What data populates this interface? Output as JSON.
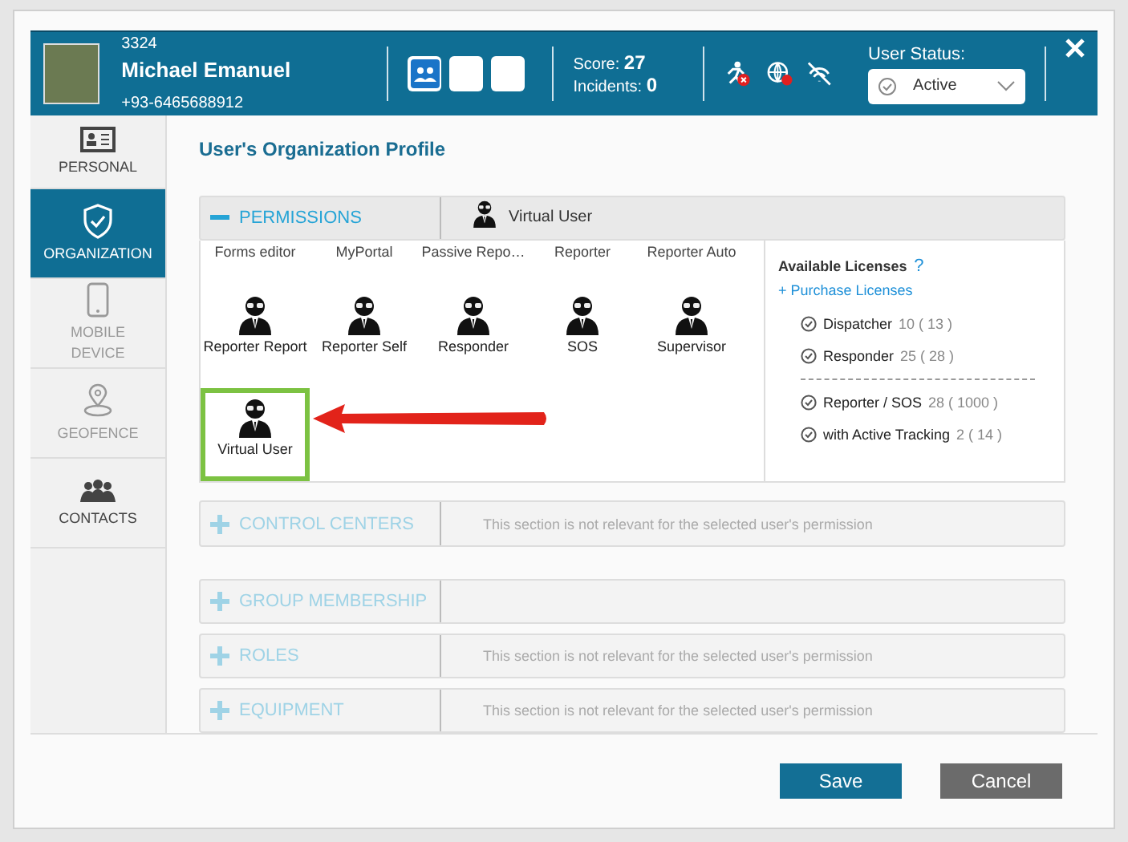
{
  "header": {
    "user_id": "3324",
    "name": "Michael Emanuel",
    "phone": "+93-6465688912",
    "score_label": "Score:",
    "score": "27",
    "incidents_label": "Incidents:",
    "incidents": "0",
    "status_label": "User Status:",
    "status_value": "Active"
  },
  "sidebar": {
    "items": [
      {
        "kind": "card",
        "label": "PERSONAL",
        "selected": false,
        "disabled": false
      },
      {
        "kind": "shield",
        "label": "ORGANIZATION",
        "selected": true,
        "disabled": false
      },
      {
        "kind": "phone",
        "label": "MOBILE DEVICE",
        "selected": false,
        "disabled": true
      },
      {
        "kind": "pin",
        "label": "GEOFENCE",
        "selected": false,
        "disabled": true
      },
      {
        "kind": "people",
        "label": "CONTACTS",
        "selected": false,
        "disabled": false
      }
    ]
  },
  "title": "User's Organization Profile",
  "sections": [
    {
      "label": "PERMISSIONS",
      "expanded": true,
      "disabled": false,
      "summary": "Virtual User"
    },
    {
      "label": "CONTROL CENTERS",
      "expanded": false,
      "disabled": true,
      "note": "This section is not relevant for the selected user's permission"
    },
    {
      "label": "GROUP MEMBERSHIP",
      "expanded": false,
      "disabled": true
    },
    {
      "label": "ROLES",
      "expanded": false,
      "disabled": true,
      "note": "This section is not relevant for the selected user's permission"
    },
    {
      "label": "EQUIPMENT",
      "expanded": false,
      "disabled": true,
      "note": "This section is not relevant for the selected user's permission"
    }
  ],
  "permissions_above": [
    "Forms editor",
    "MyPortal",
    "Passive Repo…",
    "Reporter",
    "Reporter Auto"
  ],
  "permissions": [
    {
      "label": "Reporter Report",
      "selected": false
    },
    {
      "label": "Reporter Self",
      "selected": false
    },
    {
      "label": "Responder",
      "selected": false
    },
    {
      "label": "SOS",
      "selected": false
    },
    {
      "label": "Supervisor",
      "selected": false
    },
    {
      "label": "Virtual User",
      "selected": true
    }
  ],
  "licenses": {
    "title": "Available Licenses",
    "help": "?",
    "purchase": "+ Purchase Licenses",
    "groups": [
      [
        {
          "name": "Dispatcher",
          "count": "10 ( 13 )"
        },
        {
          "name": "Responder",
          "count": "25 ( 28 )"
        }
      ],
      [
        {
          "name": "Reporter / SOS",
          "count": "28 ( 1000 )"
        },
        {
          "name": "with Active Tracking",
          "count": "2 ( 14 )"
        }
      ]
    ]
  },
  "buttons": [
    {
      "kind": "primary",
      "label": "Save"
    },
    {
      "kind": "secondary",
      "label": "Cancel"
    }
  ]
}
